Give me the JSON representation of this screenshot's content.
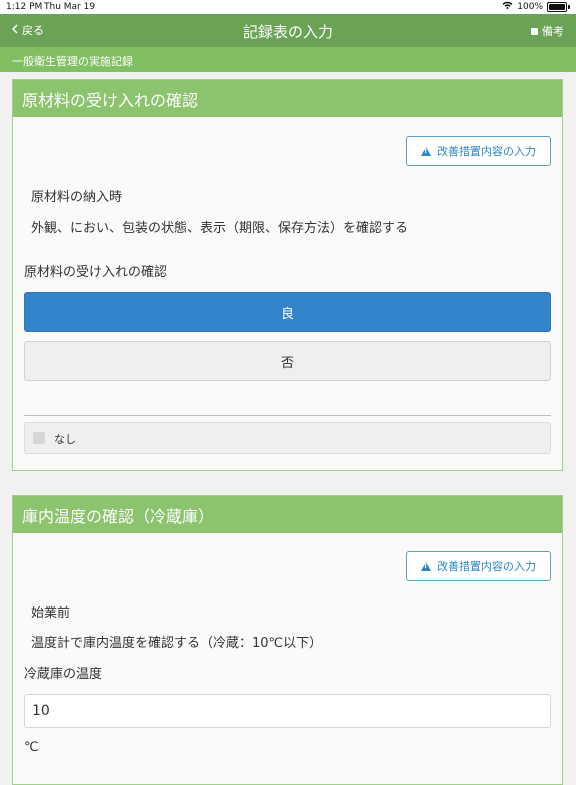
{
  "status_bar": {
    "time": "1:12 PM",
    "date": "Thu Mar 19",
    "battery": "100%"
  },
  "nav": {
    "back_label": "戻る",
    "title": "記録表の入力",
    "memo_label": "備考"
  },
  "sub_header": {
    "title": "一般衛生管理の実施記録"
  },
  "sections": [
    {
      "title": "原材料の受け入れの確認",
      "corrective_button": "改善措置内容の入力",
      "timing": "原材料の納入時",
      "instruction": "外観、におい、包装の状態、表示（期限、保存方法）を確認する",
      "question": "原材料の受け入れの確認",
      "options": [
        "良",
        "否"
      ],
      "selected_option": "良",
      "none_label": "なし",
      "none_checked": false
    },
    {
      "title": "庫内温度の確認（冷蔵庫）",
      "corrective_button": "改善措置内容の入力",
      "timing": "始業前",
      "instruction": "温度計で庫内温度を確認する（冷蔵：10℃以下）",
      "field_label": "冷蔵庫の温度",
      "temperature_value": "10",
      "unit": "℃"
    }
  ],
  "colors": {
    "nav_bar": "#6ba356",
    "sub_bar": "#80c062",
    "card_header": "#8cc46e",
    "selected_option": "#3484cc",
    "corrective_accent": "#2a87c2"
  }
}
